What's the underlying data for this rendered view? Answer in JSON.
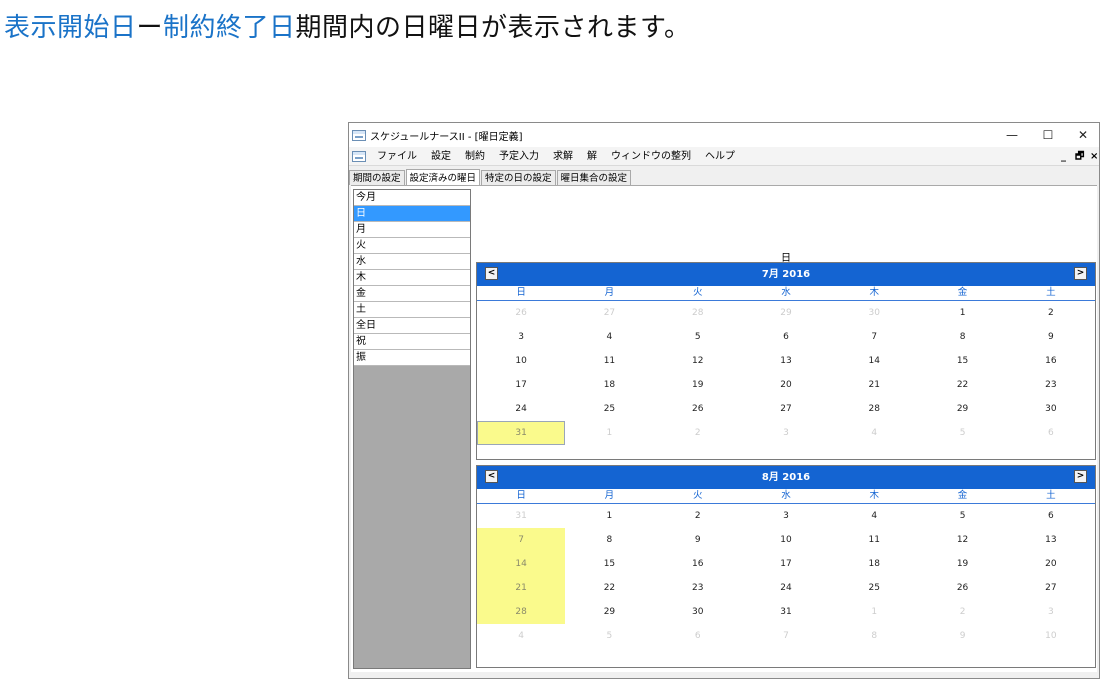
{
  "headline": {
    "part1": "表示開始日",
    "dash": "ー",
    "part2": "制約終了日",
    "part3": "期間内の日曜日が表示されます。"
  },
  "window": {
    "title": "スケジュールナースII - [曜日定義]",
    "controls": {
      "minimize": "—",
      "maximize": "☐",
      "close": "✕"
    },
    "mdi_controls": {
      "minimize": "_",
      "restore": "🗗",
      "close": "×"
    }
  },
  "menu": [
    "ファイル",
    "設定",
    "制約",
    "予定入力",
    "求解",
    "解",
    "ウィンドウの整列",
    "ヘルプ"
  ],
  "tabs": [
    {
      "label": "期間の設定",
      "active": false
    },
    {
      "label": "設定済みの曜日",
      "active": true
    },
    {
      "label": "特定の日の設定",
      "active": false
    },
    {
      "label": "曜日集合の設定",
      "active": false
    }
  ],
  "list": {
    "items": [
      "今月",
      "日",
      "月",
      "火",
      "水",
      "木",
      "金",
      "土",
      "全日",
      "祝",
      "振"
    ],
    "selected_index": 1
  },
  "selected_label": "日",
  "weekdays": [
    "日",
    "月",
    "火",
    "水",
    "木",
    "金",
    "土"
  ],
  "calendars": [
    {
      "title": "7月 2016",
      "prev": "<",
      "next": ">",
      "days": [
        {
          "d": "26",
          "s": "other"
        },
        {
          "d": "27",
          "s": "other"
        },
        {
          "d": "28",
          "s": "other"
        },
        {
          "d": "29",
          "s": "other"
        },
        {
          "d": "30",
          "s": "other"
        },
        {
          "d": "1",
          "s": ""
        },
        {
          "d": "2",
          "s": ""
        },
        {
          "d": "3",
          "s": ""
        },
        {
          "d": "4",
          "s": ""
        },
        {
          "d": "5",
          "s": ""
        },
        {
          "d": "6",
          "s": ""
        },
        {
          "d": "7",
          "s": ""
        },
        {
          "d": "8",
          "s": ""
        },
        {
          "d": "9",
          "s": ""
        },
        {
          "d": "10",
          "s": ""
        },
        {
          "d": "11",
          "s": ""
        },
        {
          "d": "12",
          "s": ""
        },
        {
          "d": "13",
          "s": ""
        },
        {
          "d": "14",
          "s": ""
        },
        {
          "d": "15",
          "s": ""
        },
        {
          "d": "16",
          "s": ""
        },
        {
          "d": "17",
          "s": ""
        },
        {
          "d": "18",
          "s": ""
        },
        {
          "d": "19",
          "s": ""
        },
        {
          "d": "20",
          "s": ""
        },
        {
          "d": "21",
          "s": ""
        },
        {
          "d": "22",
          "s": ""
        },
        {
          "d": "23",
          "s": ""
        },
        {
          "d": "24",
          "s": ""
        },
        {
          "d": "25",
          "s": ""
        },
        {
          "d": "26",
          "s": ""
        },
        {
          "d": "27",
          "s": ""
        },
        {
          "d": "28",
          "s": ""
        },
        {
          "d": "29",
          "s": ""
        },
        {
          "d": "30",
          "s": ""
        },
        {
          "d": "31",
          "s": "hl boxed"
        },
        {
          "d": "1",
          "s": "other"
        },
        {
          "d": "2",
          "s": "other"
        },
        {
          "d": "3",
          "s": "other"
        },
        {
          "d": "4",
          "s": "other"
        },
        {
          "d": "5",
          "s": "other"
        },
        {
          "d": "6",
          "s": "other"
        }
      ]
    },
    {
      "title": "8月 2016",
      "prev": "<",
      "next": ">",
      "days": [
        {
          "d": "31",
          "s": "other"
        },
        {
          "d": "1",
          "s": ""
        },
        {
          "d": "2",
          "s": ""
        },
        {
          "d": "3",
          "s": ""
        },
        {
          "d": "4",
          "s": ""
        },
        {
          "d": "5",
          "s": ""
        },
        {
          "d": "6",
          "s": ""
        },
        {
          "d": "7",
          "s": "hl"
        },
        {
          "d": "8",
          "s": ""
        },
        {
          "d": "9",
          "s": ""
        },
        {
          "d": "10",
          "s": ""
        },
        {
          "d": "11",
          "s": ""
        },
        {
          "d": "12",
          "s": ""
        },
        {
          "d": "13",
          "s": ""
        },
        {
          "d": "14",
          "s": "hl"
        },
        {
          "d": "15",
          "s": ""
        },
        {
          "d": "16",
          "s": ""
        },
        {
          "d": "17",
          "s": ""
        },
        {
          "d": "18",
          "s": ""
        },
        {
          "d": "19",
          "s": ""
        },
        {
          "d": "20",
          "s": ""
        },
        {
          "d": "21",
          "s": "hl"
        },
        {
          "d": "22",
          "s": ""
        },
        {
          "d": "23",
          "s": ""
        },
        {
          "d": "24",
          "s": ""
        },
        {
          "d": "25",
          "s": ""
        },
        {
          "d": "26",
          "s": ""
        },
        {
          "d": "27",
          "s": ""
        },
        {
          "d": "28",
          "s": "hl"
        },
        {
          "d": "29",
          "s": ""
        },
        {
          "d": "30",
          "s": ""
        },
        {
          "d": "31",
          "s": ""
        },
        {
          "d": "1",
          "s": "other"
        },
        {
          "d": "2",
          "s": "other"
        },
        {
          "d": "3",
          "s": "other"
        },
        {
          "d": "4",
          "s": "other"
        },
        {
          "d": "5",
          "s": "other"
        },
        {
          "d": "6",
          "s": "other"
        },
        {
          "d": "7",
          "s": "other"
        },
        {
          "d": "8",
          "s": "other"
        },
        {
          "d": "9",
          "s": "other"
        },
        {
          "d": "10",
          "s": "other"
        }
      ]
    }
  ],
  "colors": {
    "accent": "#1464d2",
    "highlight": "#fafa8c",
    "selected": "#3399ff"
  }
}
